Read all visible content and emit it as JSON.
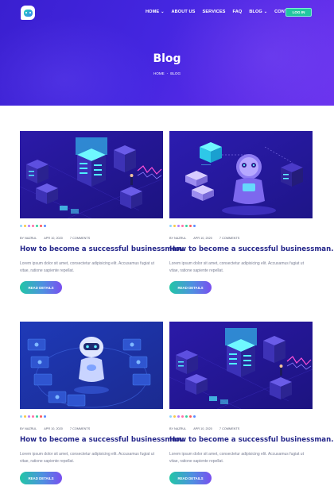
{
  "header": {
    "nav": [
      {
        "label": "HOME",
        "dropdown": true
      },
      {
        "label": "ABOUT US",
        "dropdown": false
      },
      {
        "label": "SERVICES",
        "dropdown": false
      },
      {
        "label": "FAQ",
        "dropdown": false
      },
      {
        "label": "BLOG",
        "dropdown": true
      },
      {
        "label": "CONTACT",
        "dropdown": false
      }
    ],
    "login_label": "LOG IN"
  },
  "hero": {
    "title": "Blog",
    "breadcrumb": {
      "home": "HOME",
      "separator": "-",
      "current": "BLOG"
    }
  },
  "posts": [
    {
      "image": "server-isometric",
      "author": "BY NAZRUL",
      "date": "APR 10, 2020",
      "comments": "7 COMMENTS",
      "title": "How to become a successful businessman.",
      "excerpt": "Lorem ipsum dolor sit amet, consectetur adipisicing elit. Accusamus fugiat ut vitae, ratione sapiente repellat.",
      "button": "READ DETAILS"
    },
    {
      "image": "robot-isometric",
      "author": "BY NAZRUL",
      "date": "APR 10, 2020",
      "comments": "7 COMMENTS",
      "title": "How to become a successful businessman.",
      "excerpt": "Lorem ipsum dolor sit amet, consectetur adipisicing elit. Accusamus fugiat ut vitae, ratione sapiente repellat.",
      "button": "READ DETAILS"
    },
    {
      "image": "robot-screens",
      "author": "BY NAZRUL",
      "date": "APR 10, 2020",
      "comments": "7 COMMENTS",
      "title": "How to become a successful businessman.",
      "excerpt": "Lorem ipsum dolor sit amet, consectetur adipisicing elit. Accusamus fugiat ut vitae, ratione sapiente repellat.",
      "button": "READ DETAILS"
    },
    {
      "image": "server-isometric",
      "author": "BY NAZRUL",
      "date": "APR 10, 2020",
      "comments": "7 COMMENTS",
      "title": "How to become a successful businessman.",
      "excerpt": "Lorem ipsum dolor sit amet, consectetur adipisicing elit. Accusamus fugiat ut vitae, ratione sapiente repellat.",
      "button": "READ DETAILS"
    }
  ],
  "colors": {
    "hero_start": "#3a1fd0",
    "hero_end": "#6a32ee",
    "accent_teal": "#22c7a0",
    "title_navy": "#24268a",
    "tag_dots": [
      "#8fd3ff",
      "#f7c948",
      "#b57bff",
      "#ff6fa8",
      "#3ad29f",
      "#ff5a5a",
      "#5b8cff"
    ]
  }
}
